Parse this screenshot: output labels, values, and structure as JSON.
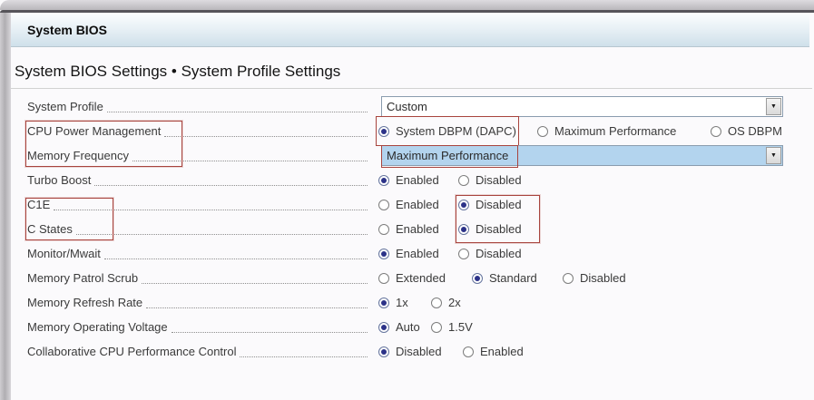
{
  "window": {
    "title": "System BIOS"
  },
  "heading": "System BIOS Settings • System Profile Settings",
  "icons": {
    "dropdown_arrow": "▼"
  },
  "colors": {
    "annotation_red": "#a8443e",
    "dropdown_highlight": "#b3d4ee",
    "radio_selected": "#2c3288",
    "titlebar_blue": "#cfe0ea"
  },
  "rows": [
    {
      "label": "System Profile",
      "control": "dropdown",
      "value": "Custom",
      "highlighted": false,
      "label_annotated": false,
      "value_annotated": false
    },
    {
      "label": "CPU Power Management",
      "control": "radio",
      "label_annotated": true,
      "options": [
        {
          "label": "System DBPM (DAPC)",
          "selected": true,
          "annotated": true
        },
        {
          "label": "Maximum Performance",
          "selected": false,
          "annotated": false
        },
        {
          "label": "OS DBPM",
          "selected": false,
          "annotated": false
        }
      ]
    },
    {
      "label": "Memory Frequency",
      "control": "dropdown",
      "value": "Maximum Performance",
      "highlighted": true,
      "label_annotated": true,
      "value_annotated": true
    },
    {
      "label": "Turbo Boost",
      "control": "radio",
      "label_annotated": false,
      "options": [
        {
          "label": "Enabled",
          "selected": true,
          "annotated": false
        },
        {
          "label": "Disabled",
          "selected": false,
          "annotated": false
        }
      ]
    },
    {
      "label": "C1E",
      "control": "radio",
      "label_annotated": true,
      "options": [
        {
          "label": "Enabled",
          "selected": false,
          "annotated": true
        },
        {
          "label": "Disabled",
          "selected": true,
          "annotated": false
        }
      ]
    },
    {
      "label": "C States",
      "control": "radio",
      "label_annotated": true,
      "options": [
        {
          "label": "Enabled",
          "selected": false,
          "annotated": true
        },
        {
          "label": "Disabled",
          "selected": true,
          "annotated": false
        }
      ]
    },
    {
      "label": "Monitor/Mwait",
      "control": "radio",
      "label_annotated": false,
      "options": [
        {
          "label": "Enabled",
          "selected": true,
          "annotated": false
        },
        {
          "label": "Disabled",
          "selected": false,
          "annotated": false
        }
      ]
    },
    {
      "label": "Memory Patrol Scrub",
      "control": "radio",
      "label_annotated": false,
      "options": [
        {
          "label": "Extended",
          "selected": false,
          "annotated": false
        },
        {
          "label": "Standard",
          "selected": true,
          "annotated": false
        },
        {
          "label": "Disabled",
          "selected": false,
          "annotated": false
        }
      ]
    },
    {
      "label": "Memory Refresh Rate",
      "control": "radio",
      "label_annotated": false,
      "options": [
        {
          "label": "1x",
          "selected": true,
          "annotated": false
        },
        {
          "label": "2x",
          "selected": false,
          "annotated": false
        }
      ]
    },
    {
      "label": "Memory Operating Voltage",
      "control": "radio",
      "label_annotated": false,
      "options": [
        {
          "label": "Auto",
          "selected": true,
          "annotated": false
        },
        {
          "label": "1.5V",
          "selected": false,
          "annotated": false
        }
      ]
    },
    {
      "label": "Collaborative CPU Performance Control",
      "control": "radio",
      "label_annotated": false,
      "options": [
        {
          "label": "Disabled",
          "selected": true,
          "annotated": false
        },
        {
          "label": "Enabled",
          "selected": false,
          "annotated": false
        }
      ]
    }
  ]
}
